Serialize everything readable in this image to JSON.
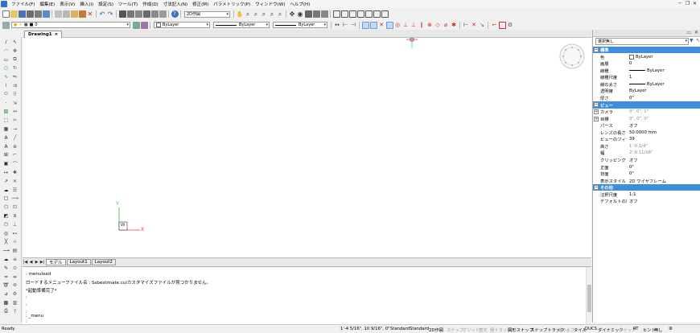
{
  "menubar": {
    "items": [
      "ファイル(F)",
      "編集(E)",
      "表示(V)",
      "挿入(I)",
      "設定(S)",
      "ツール(T)",
      "作成(D)",
      "寸法記入(N)",
      "修正(M)",
      "パラメトリック(P)",
      "ウィンドウ(W)",
      "ヘルプ(H)"
    ]
  },
  "toolbar1": {
    "view_combo": "2D作図"
  },
  "toolbar2": {
    "layer_combo": "0",
    "color_combo": "ByLayer",
    "linetype_combo": "ByLayer",
    "lineweight_combo": "ByLayer"
  },
  "drawing": {
    "tab_label": "Drawing1",
    "tab_close": "×",
    "ucs_y": "Y",
    "ucs_x": "X",
    "ucs_w": "W"
  },
  "layout_tabs": {
    "nav": [
      "|◀",
      "◀",
      "▶",
      "▶|"
    ],
    "tabs": [
      "モデル",
      "Layout1",
      "Layout2"
    ],
    "active": "モデル"
  },
  "command": {
    "lines": [
      ": menuload",
      "ロードするメニューファイル名 : Ssbestimate.cuiカスタマイズファイルが見つかりません。",
      "*起動準備完了*",
      ":",
      ":",
      ":",
      ": _menu",
      ":"
    ]
  },
  "properties": {
    "selection": "選択無し",
    "rows": [
      {
        "kind": "cat",
        "name": "標準"
      },
      {
        "name": "色",
        "value": "ByLayer",
        "swatch": true
      },
      {
        "name": "画層",
        "value": "0"
      },
      {
        "name": "線種",
        "value": "ByLayer",
        "line": true
      },
      {
        "name": "線種尺度",
        "value": "1"
      },
      {
        "name": "線の太さ",
        "value": "ByLayer",
        "line": true
      },
      {
        "name": "透明度",
        "value": "ByLayer"
      },
      {
        "name": "厚さ",
        "value": "0\""
      },
      {
        "kind": "cat",
        "name": "ビュー"
      },
      {
        "name": "カメラ",
        "value": "0\", 0\", 1\"",
        "grey": true,
        "expand": true
      },
      {
        "name": "目標",
        "value": "0\", 0\", 0\"",
        "grey": true,
        "expand": true
      },
      {
        "name": "パース",
        "value": "オフ"
      },
      {
        "name": "レンズの長さ",
        "value": "50.0000 mm"
      },
      {
        "name": "ビューのフィールド",
        "value": "39"
      },
      {
        "name": "高さ",
        "value": "1'-0 1/4\"",
        "grey": true
      },
      {
        "name": "幅",
        "value": "2'-0 11/16\"",
        "grey": true
      },
      {
        "name": "クリッピング",
        "value": "オフ"
      },
      {
        "name": "正面",
        "value": "0\""
      },
      {
        "name": "背面",
        "value": "0\""
      },
      {
        "name": "表示スタイル",
        "value": "2D ワイヤフレーム"
      },
      {
        "kind": "cat",
        "name": "その他"
      },
      {
        "name": "注釈尺度",
        "value": "1:1"
      },
      {
        "name": "デフォルトの尺度",
        "value": "オフ"
      }
    ]
  },
  "statusbar": {
    "ready": "Ready",
    "coords": "1'-4 5/16\", 10 9/16\", 0\"",
    "items": [
      {
        "label": "Standard",
        "on": true
      },
      {
        "label": "Standard",
        "on": true
      },
      {
        "label": "2D作図",
        "on": true
      },
      {
        "label": "スナップ",
        "on": false
      },
      {
        "label": "グリッド",
        "on": false
      },
      {
        "label": "直交",
        "on": false
      },
      {
        "label": "極トラック",
        "on": false
      },
      {
        "label": "図形スナップ",
        "on": true
      },
      {
        "label": "スナップトラック",
        "on": true
      },
      {
        "label": "線の太さ",
        "on": false
      },
      {
        "label": "タイル",
        "on": true
      },
      {
        "label": "DUCS",
        "on": true
      },
      {
        "label": "ダイナミック",
        "on": true
      },
      {
        "label": "クイック",
        "on": false
      },
      {
        "label": "RT",
        "on": true
      },
      {
        "label": "ヒント",
        "on": true
      },
      {
        "label": "無し",
        "on": true
      }
    ]
  },
  "colors": {
    "accent": "#3d8ede",
    "ucs_y": "#2fbf3f",
    "ucs_x": "#e03c3c"
  }
}
